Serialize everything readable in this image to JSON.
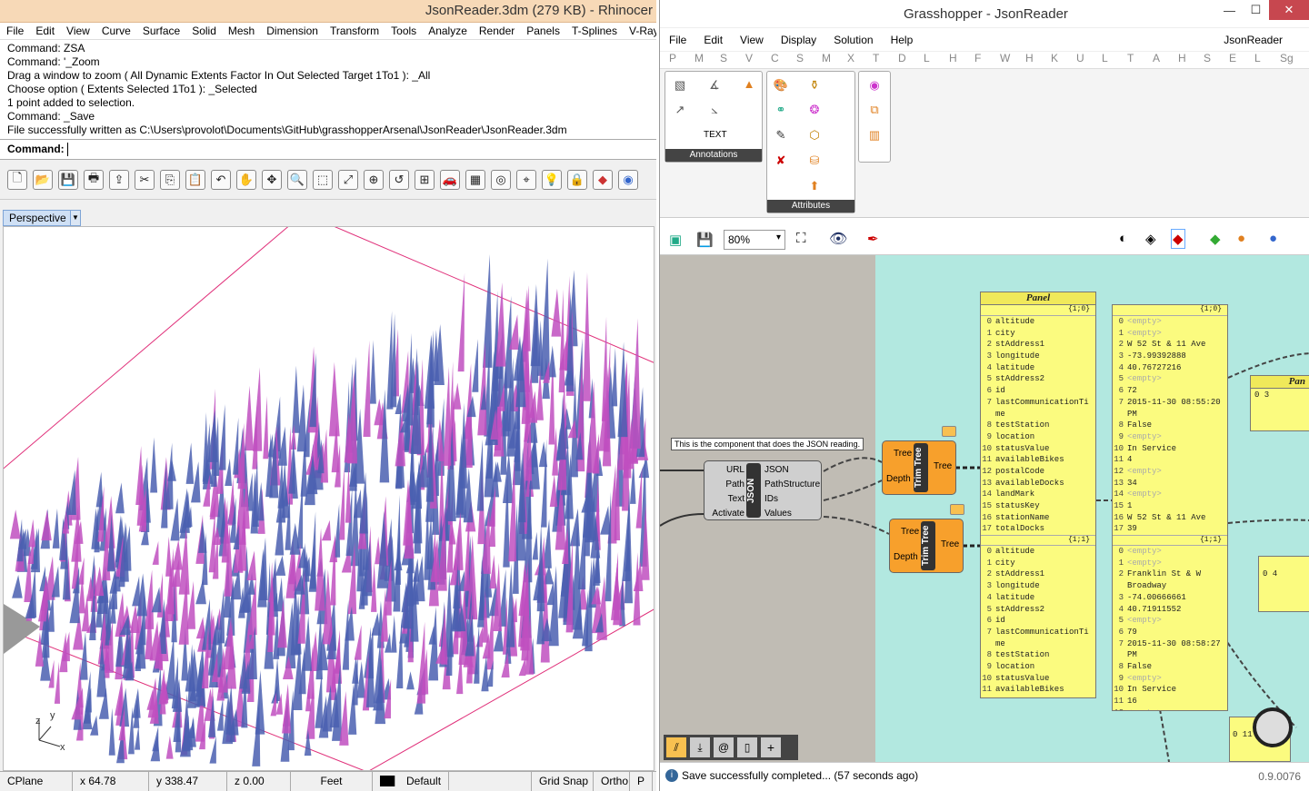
{
  "rhino": {
    "title": "JsonReader.3dm (279 KB) - Rhinocer",
    "menu": [
      "File",
      "Edit",
      "View",
      "Curve",
      "Surface",
      "Solid",
      "Mesh",
      "Dimension",
      "Transform",
      "Tools",
      "Analyze",
      "Render",
      "Panels",
      "T-Splines",
      "V-Ray"
    ],
    "history": [
      "Command: ZSA",
      "Command: '_Zoom",
      "Drag a window to zoom ( All  Dynamic  Extents  Factor  In  Out  Selected  Target  1To1 ): _All",
      "Choose option ( Extents  Selected  1To1 ): _Selected",
      "1 point added to selection.",
      "Command: _Save",
      "File successfully written as C:\\Users\\provolot\\Documents\\GitHub\\grasshopperArsenal\\JsonReader\\JsonReader.3dm"
    ],
    "command_label": "Command:",
    "viewport_name": "Perspective",
    "axis": {
      "x": "x",
      "y": "y",
      "z": "z"
    },
    "status": {
      "cplane": "CPlane",
      "x": "x 64.78",
      "y": "y 338.47",
      "z": "z 0.00",
      "units": "Feet",
      "layer": "Default",
      "grid_snap": "Grid Snap",
      "ortho": "Ortho",
      "planar": "P"
    }
  },
  "gh": {
    "title": "Grasshopper - JsonReader",
    "menu": [
      "File",
      "Edit",
      "View",
      "Display",
      "Solution",
      "Help"
    ],
    "doc_name": "JsonReader",
    "tabs": [
      "P",
      "M",
      "S",
      "V",
      "C",
      "S",
      "M",
      "X",
      "T",
      "D",
      "L",
      "H",
      "F",
      "W",
      "H",
      "K",
      "U",
      "L",
      "T",
      "A",
      "H",
      "S",
      "E",
      "L",
      "Sg"
    ],
    "ribbon_groups": {
      "annotations": "Annotations",
      "attributes": "Attributes",
      "text_icon": "TEXT"
    },
    "zoom": "80%",
    "tooltip": "This is the component that does the JSON reading.",
    "json_comp": {
      "inputs": [
        "URL",
        "Path",
        "Text",
        "Activate"
      ],
      "outputs": [
        "JSON",
        "PathStructure",
        "IDs",
        "Values"
      ],
      "name": "JSON"
    },
    "trim1": {
      "in_tree": "Tree",
      "in_depth": "Depth",
      "name": "Trim Tree",
      "out": "Tree"
    },
    "trim2": {
      "in_tree": "Tree",
      "in_depth": "Depth",
      "name": "Trim Tree",
      "out": "Tree"
    },
    "panel1": {
      "title": "Panel",
      "path_a": "{1;0}",
      "rows_a": [
        "altitude",
        "city",
        "stAddress1",
        "longitude",
        "latitude",
        "stAddress2",
        "id",
        "lastCommunicationTi",
        "me",
        "testStation",
        "location",
        "statusValue",
        "availableBikes",
        "postalCode",
        "availableDocks",
        "landMark",
        "statusKey",
        "stationName",
        "totalDocks"
      ],
      "idx_a": [
        "0",
        "1",
        "2",
        "3",
        "4",
        "5",
        "6",
        "7",
        "",
        "8",
        "9",
        "10",
        "11",
        "12",
        "13",
        "14",
        "15",
        "16",
        "17"
      ],
      "path_b": "{1;1}",
      "rows_b": [
        "altitude",
        "city",
        "stAddress1",
        "longitude",
        "latitude",
        "stAddress2",
        "id",
        "lastCommunicationTi",
        "me",
        "testStation",
        "location",
        "statusValue",
        "availableBikes"
      ],
      "idx_b": [
        "0",
        "1",
        "2",
        "3",
        "4",
        "5",
        "6",
        "7",
        "",
        "8",
        "9",
        "10",
        "11"
      ]
    },
    "panel2": {
      "path_a": "{1;0}",
      "rows_a": [
        "<empty>",
        "<empty>",
        "W 52 St & 11 Ave",
        "-73.99392888",
        "40.76727216",
        "<empty>",
        "72",
        "2015-11-30 08:55:20",
        "PM",
        "False",
        "<empty>",
        "In Service",
        "4",
        "<empty>",
        "34",
        "<empty>",
        "1",
        "W 52 St & 11 Ave",
        "39"
      ],
      "idx_a": [
        "0",
        "1",
        "2",
        "3",
        "4",
        "5",
        "6",
        "7",
        "",
        "8",
        "9",
        "10",
        "11",
        "12",
        "13",
        "14",
        "15",
        "16",
        "17"
      ],
      "path_b": "{1;1}",
      "rows_b": [
        "<empty>",
        "<empty>",
        "Franklin St & W",
        "Broadway",
        "-74.00666661",
        "40.71911552",
        "<empty>",
        "79",
        "2015-11-30 08:58:27",
        "PM",
        "False",
        "<empty>",
        "In Service",
        "16",
        "<empty>"
      ],
      "idx_b": [
        "0",
        "1",
        "2",
        "",
        "3",
        "4",
        "5",
        "6",
        "7",
        "",
        "8",
        "9",
        "10",
        "11",
        "12"
      ]
    },
    "panel3": {
      "title": "Pan",
      "row": "0 3"
    },
    "panel4": {
      "row": "0 4"
    },
    "panel5": {
      "row": "0 11"
    },
    "status": "Save successfully completed... (57 seconds ago)",
    "version": "0.9.0076"
  }
}
